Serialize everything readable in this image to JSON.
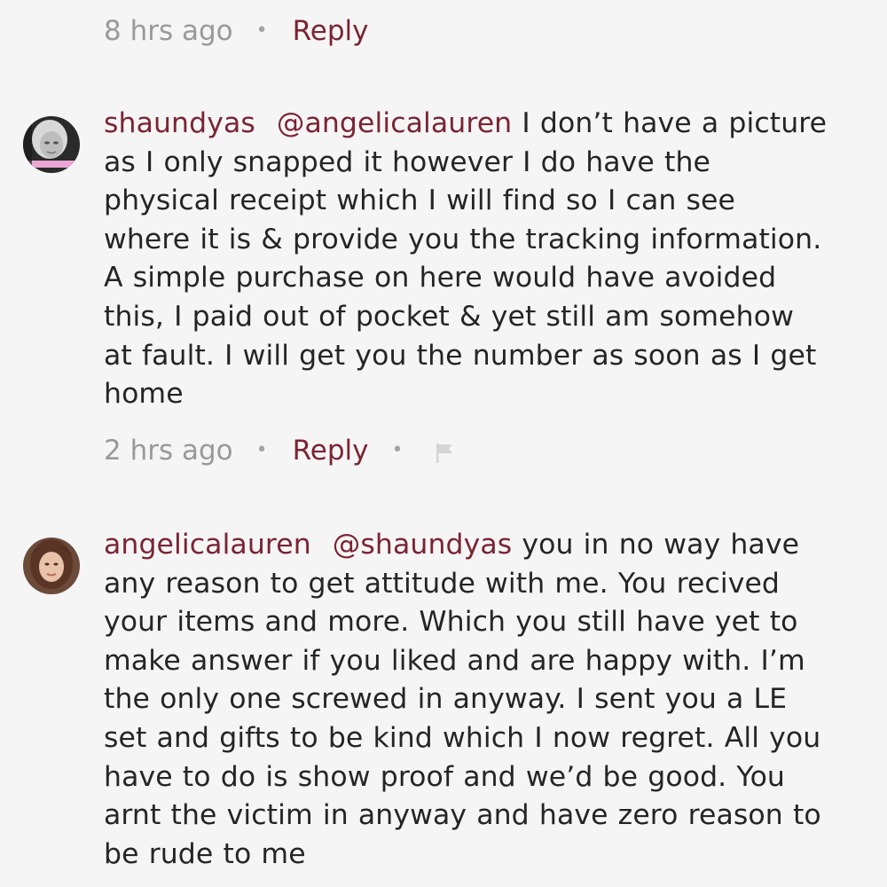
{
  "comments": [
    {
      "time": "8 hrs ago",
      "reply_label": "Reply"
    },
    {
      "username": "shaundyas",
      "mention": "@angelicalauren",
      "lines": [
        " I don’t have a picture",
        "as I only snapped it however I do have the",
        "physical receipt which I will find so I can see",
        "where it is & provide you the tracking information.",
        "A simple purchase on here would have avoided",
        "this, I paid out of pocket & yet still am somehow",
        "at fault. I will get you the number as soon as I get",
        "home"
      ],
      "time": "2 hrs ago",
      "reply_label": "Reply",
      "flag_icon": "flag-icon"
    },
    {
      "username": "angelicalauren",
      "mention": "@shaundyas",
      "lines": [
        " you in no way have",
        "any reason to get attitude with me. You recived",
        "your items and more. Which you still have yet to",
        "make answer if you liked and are happy with. I’m",
        "the only one screwed in anyway. I sent you a LE",
        "set and gifts to be kind which I now regret. All you",
        "have to do is show proof and we’d be good. You",
        "arnt the victim in anyway and have zero reason to",
        "be rude to me"
      ]
    }
  ],
  "separator": "•",
  "colors": {
    "accent": "#7a2434",
    "muted": "#9a9899",
    "text": "#262425",
    "background": "#f6f5f6"
  }
}
